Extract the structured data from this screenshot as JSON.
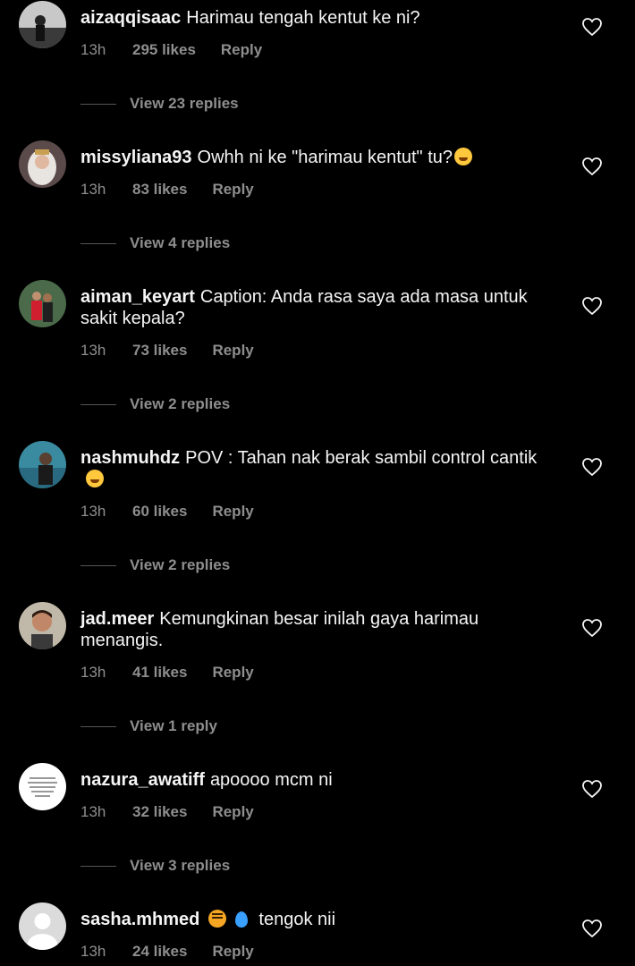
{
  "comments": [
    {
      "username": "aizaqqisaac",
      "text": "Harimau tengah kentut ke ni?",
      "time": "13h",
      "likes": "295 likes",
      "reply": "Reply",
      "view_replies": "View 23 replies",
      "avatar": "photo-person-dark"
    },
    {
      "username": "missyliana93",
      "text": "Owhh ni ke \"harimau kentut\" tu?",
      "emoji": "laughing-tears-emoji",
      "time": "13h",
      "likes": "83 likes",
      "reply": "Reply",
      "view_replies": "View 4 replies",
      "avatar": "photo-woman-hijab"
    },
    {
      "username": "aiman_keyart",
      "text": "Caption: Anda rasa saya ada masa untuk sakit kepala?",
      "time": "13h",
      "likes": "73 likes",
      "reply": "Reply",
      "view_replies": "View 2 replies",
      "avatar": "photo-couple"
    },
    {
      "username": "nashmuhdz",
      "text": "POV : Tahan nak berak sambil control cantik",
      "emoji": "zany-face-emoji",
      "time": "13h",
      "likes": "60 likes",
      "reply": "Reply",
      "view_replies": "View 2 replies",
      "avatar": "photo-sea"
    },
    {
      "username": "jad.meer",
      "text": "Kemungkinan besar inilah gaya harimau menangis.",
      "time": "13h",
      "likes": "41 likes",
      "reply": "Reply",
      "view_replies": "View 1 reply",
      "avatar": "photo-man"
    },
    {
      "username": "nazura_awatiff",
      "text": "apoooo mcm ni",
      "time": "13h",
      "likes": "32 likes",
      "reply": "Reply",
      "view_replies": "View 3 replies",
      "avatar": "white-text-avatar"
    },
    {
      "username": "sasha.mhmed",
      "text": "tengok nii",
      "emoji_prefix": [
        "tiger-face-emoji",
        "droplet-emoji"
      ],
      "time": "13h",
      "likes": "24 likes",
      "reply": "Reply",
      "avatar": "default-avatar"
    }
  ],
  "colors": {
    "background": "#000000",
    "primary_text": "#f5f5f5",
    "secondary_text": "#8e8e8e"
  }
}
